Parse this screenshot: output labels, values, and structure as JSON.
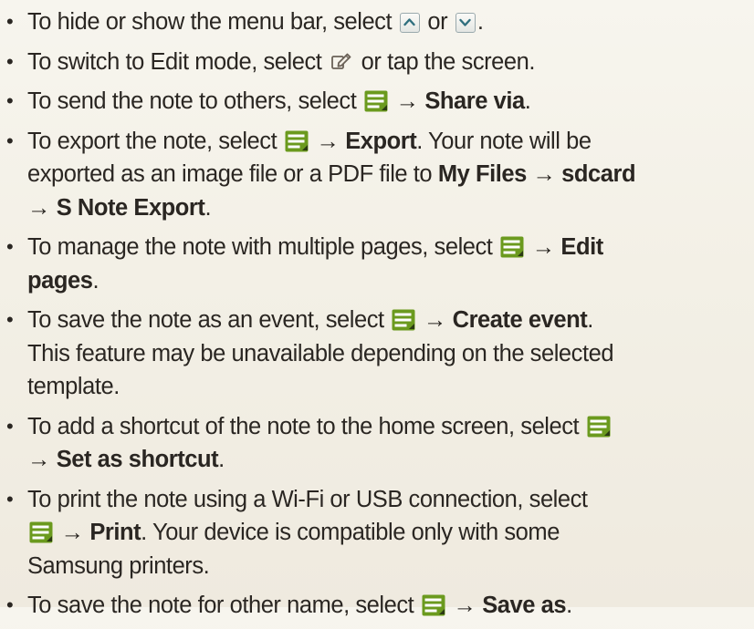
{
  "items": [
    {
      "lines": [
        [
          "To hide or show the menu bar, select ",
          "{chev-up}",
          " or ",
          "{chev-down}",
          "."
        ]
      ]
    },
    {
      "text_a": "To hide or show the menu bar, select ",
      "text_b": " or ",
      "text_c": "."
    },
    {
      "text_a": "To switch to Edit mode, select ",
      "text_b": " or tap the screen."
    },
    {
      "text_a": "To send the note to others, select ",
      "arrow": " → ",
      "bold": "Share via",
      "text_b": "."
    },
    {
      "text_a": "To export the note, select ",
      "arrow": " → ",
      "bold_a": "Export",
      "text_b": ". Your note will be",
      "line2_a": "exported as an image file or a PDF file to ",
      "bold_b": "My Files",
      "arrow2": " → ",
      "bold_c": "sdcard",
      "line3_arrow": "→ ",
      "bold_d": "S Note Export",
      "text_end": "."
    },
    {
      "text_a": "To manage the note with multiple pages, select ",
      "arrow": " → ",
      "bold_a": "Edit",
      "bold_b": "pages",
      "text_end": "."
    },
    {
      "text_a": "To save the note as an event, select ",
      "arrow": " → ",
      "bold": "Create event",
      "text_b": ".",
      "line2": "This feature may be unavailable depending on the selected",
      "line3": "template."
    },
    {
      "text_a": "To add a shortcut of the note to the home screen, select ",
      "line2_arrow": "→ ",
      "bold": "Set as shortcut",
      "text_end": "."
    },
    {
      "text_a": "To print the note using a Wi-Fi or USB connection, select",
      "arrow": " → ",
      "bold": "Print",
      "text_b": ". Your device is compatible only with some",
      "line3": "Samsung printers."
    },
    {
      "text_a": "To save the note for other name, select ",
      "arrow": " → ",
      "bold": "Save as",
      "text_end": "."
    }
  ],
  "bullet": "•",
  "icons": {
    "menu": "menu-icon",
    "edit": "edit-mode-icon",
    "up": "chevron-up-icon",
    "down": "chevron-down-icon"
  },
  "colors": {
    "menu_icon": "#6b9a1e",
    "chev_border": "#9aa9ad",
    "chev_arrow": "#2f6f7e"
  }
}
